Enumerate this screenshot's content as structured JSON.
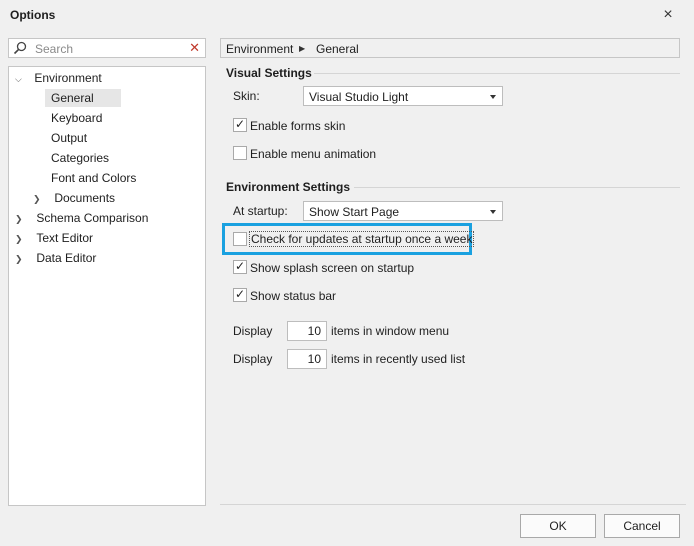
{
  "dialog": {
    "title": "Options",
    "close_icon": "×"
  },
  "search": {
    "placeholder": "Search",
    "clear_icon": "✕"
  },
  "tree": {
    "environment": "Environment",
    "general": "General",
    "keyboard": "Keyboard",
    "output": "Output",
    "categories": "Categories",
    "font_colors": "Font and Colors",
    "documents": "Documents",
    "schema": "Schema Comparison",
    "text_editor": "Text Editor",
    "data_editor": "Data Editor"
  },
  "breadcrumb": {
    "part1": "Environment",
    "part2": "General"
  },
  "visual": {
    "title": "Visual Settings",
    "skin_label": "Skin:",
    "skin_value": "Visual Studio Light",
    "forms_skin": "Enable forms skin",
    "forms_skin_checked": true,
    "menu_anim": "Enable menu animation",
    "menu_anim_checked": false
  },
  "env": {
    "title": "Environment Settings",
    "startup_label": "At startup:",
    "startup_value": "Show Start Page",
    "check_updates": "Check for updates at startup once a week",
    "check_updates_checked": false,
    "splash": "Show splash screen on startup",
    "splash_checked": true,
    "status_bar": "Show status bar",
    "status_bar_checked": true,
    "display1_label": "Display",
    "display1_value": "10",
    "display1_suffix": "items in window menu",
    "display2_label": "Display",
    "display2_value": "10",
    "display2_suffix": "items in recently used list"
  },
  "buttons": {
    "ok": "OK",
    "cancel": "Cancel"
  },
  "colors": {
    "highlight": "#1aa1e0"
  }
}
